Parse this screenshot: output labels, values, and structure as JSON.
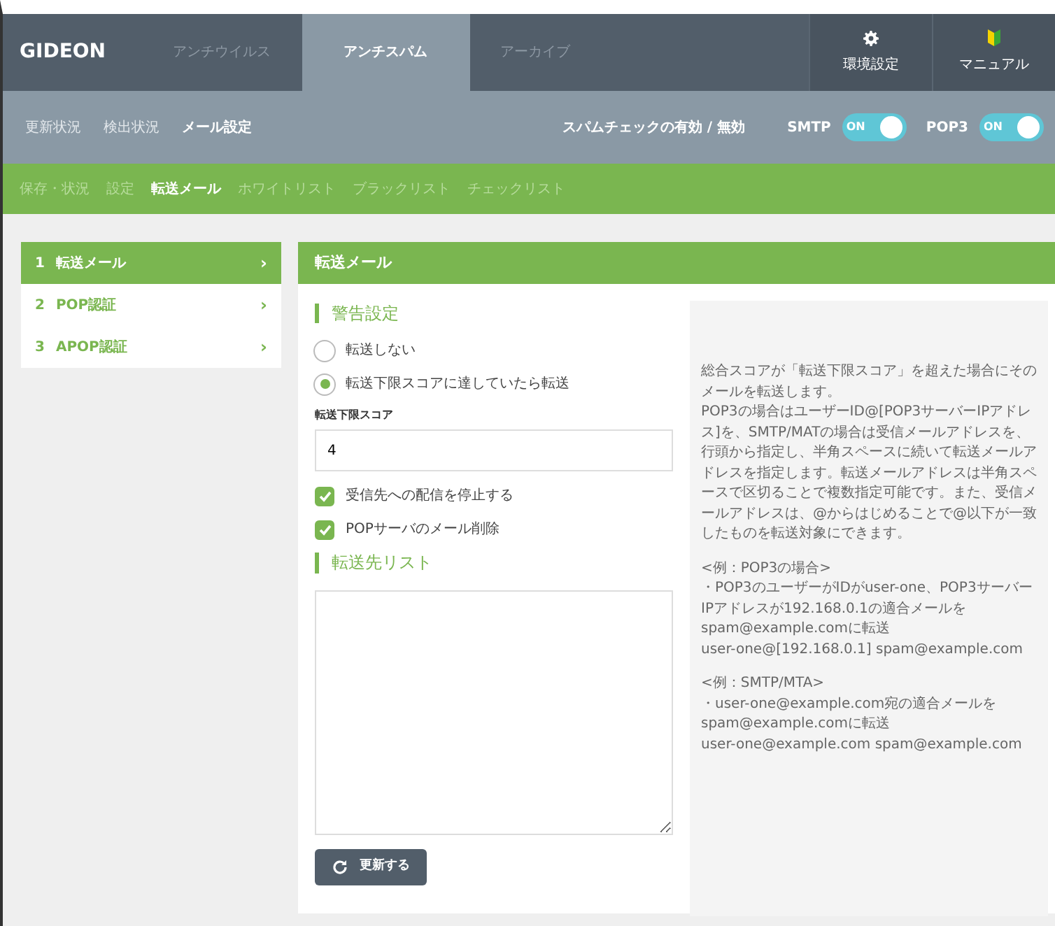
{
  "brand": "GIDEON",
  "main_tabs": [
    {
      "label": "アンチウイルス",
      "selected": false
    },
    {
      "label": "アンチスパム",
      "selected": true
    },
    {
      "label": "アーカイブ",
      "selected": false
    }
  ],
  "tool_buttons": [
    {
      "label": "環境設定",
      "kind": "gear"
    },
    {
      "label": "マニュアル",
      "kind": "leaf"
    }
  ],
  "sub_tabs": [
    {
      "label": "更新状況",
      "selected": false
    },
    {
      "label": "検出状況",
      "selected": false
    },
    {
      "label": "メール設定",
      "selected": true
    }
  ],
  "spam_check": {
    "label": "スパムチェックの有効 / 無効",
    "toggles": [
      {
        "label": "SMTP",
        "on": true,
        "text": "ON"
      },
      {
        "label": "POP3",
        "on": true,
        "text": "ON"
      }
    ]
  },
  "setting_tabs": [
    {
      "label": "保存・状況",
      "selected": false
    },
    {
      "label": "設定",
      "selected": false
    },
    {
      "label": "転送メール",
      "selected": true
    },
    {
      "label": "ホワイトリスト",
      "selected": false
    },
    {
      "label": "ブラックリスト",
      "selected": false
    },
    {
      "label": "チェックリスト",
      "selected": false
    }
  ],
  "sidebar": {
    "items": [
      {
        "number": "1",
        "label": "転送メール",
        "selected": true,
        "arrow": "›"
      },
      {
        "number": "2",
        "label": "POP認証",
        "selected": false,
        "arrow": "›"
      },
      {
        "number": "3",
        "label": "APOP認証",
        "selected": false,
        "arrow": "›"
      }
    ]
  },
  "panel": {
    "title": "転送メール",
    "section_1": "警告設定",
    "radios": [
      {
        "label": "転送しない",
        "selected": false
      },
      {
        "label": "転送下限スコアに達していたら転送",
        "selected": true
      }
    ],
    "score_field": {
      "label": "転送下限スコア",
      "value": "4"
    },
    "checkboxes": [
      {
        "label": "受信先への配信を停止する",
        "checked": true
      },
      {
        "label": "POPサーバのメール削除",
        "checked": true
      }
    ],
    "section_2": "転送先リスト",
    "update_button": "更新する",
    "help": [
      [
        "総合スコアが「転送下限スコア」を超えた場合にそのメールを転送します。",
        "POP3の場合はユーザーID@[POP3サーバーIPアドレス]を、SMTP/MATの場合は受信メールアドレスを、行頭から指定し、半角スペースに続いて転送メールアドレスを指定します。転送メールアドレスは半角スペースで区切ることで複数指定可能です。また、受信メールアドレスは、@からはじめることで@以下が一致したものを転送対象にできます。"
      ],
      [
        "<例：POP3の場合>",
        "・POP3のユーザーがIDがuser-one、POP3サーバーIPアドレスが192.168.0.1の適合メールをspam@example.comに転送",
        "user-one@[192.168.0.1] spam@example.com"
      ],
      [
        "<例：SMTP/MTA>",
        "・user-one@example.com宛の適合メールをspam@example.comに転送",
        "user-one@example.com spam@example.com"
      ]
    ]
  }
}
